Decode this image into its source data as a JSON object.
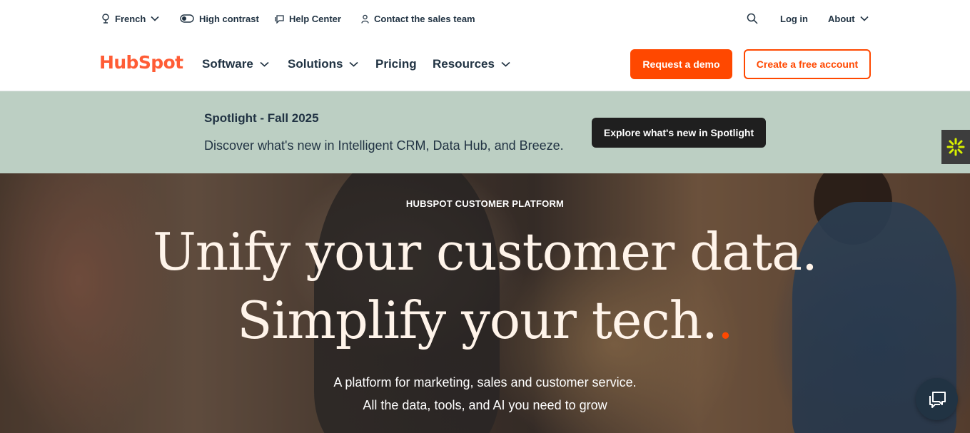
{
  "utility": {
    "language": "French",
    "contrast": "High contrast",
    "help": "Help Center",
    "sales": "Contact the sales team",
    "login": "Log in",
    "about": "About"
  },
  "nav": {
    "logo": "HubSpot",
    "items": [
      "Software",
      "Solutions",
      "Pricing",
      "Resources"
    ],
    "demo": "Request a demo",
    "free": "Create a free account"
  },
  "banner": {
    "title": "Spotlight - Fall 2025",
    "text": "Discover what's new in Intelligent CRM, Data Hub, and Breeze.",
    "button": "Explore what's new in Spotlight"
  },
  "hero": {
    "eyebrow": "HUBSPOT CUSTOMER PLATFORM",
    "line1": "Unify your customer data.",
    "line2": "Simplify your tech.",
    "dot": ".",
    "sub1": "A platform for marketing, sales and customer service.",
    "sub2": "All the data, tools, and AI you need to grow"
  },
  "colors": {
    "accent": "#ff4800",
    "navy": "#213343",
    "banner_bg": "#bccfc3"
  },
  "icons": [
    "globe-icon",
    "toggle-icon",
    "help-chat-icon",
    "person-icon",
    "search-icon",
    "chevron-down-icon",
    "sparkle-icon",
    "chat-icon"
  ]
}
